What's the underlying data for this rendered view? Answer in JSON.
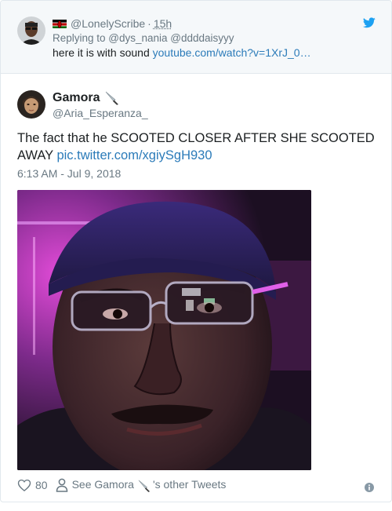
{
  "parent_tweet": {
    "handle": "@LonelyScribe",
    "separator": "·",
    "time": "15h",
    "replying_to": "Replying to @dys_nania @ddddaisyyy",
    "text": "here it is with sound ",
    "link": "youtube.com/watch?v=1XrJ_0…",
    "flag_icon": "kenya-flag-icon"
  },
  "tweet": {
    "author_name": "Gamora",
    "author_handle": "@Aria_Esperanza_",
    "text_before_link": "The fact that he SCOOTED CLOSER AFTER SHE SCOOTED AWAY ",
    "link": "pic.twitter.com/xgiySgH930",
    "timestamp": "6:13 AM - Jul 9, 2018"
  },
  "actions": {
    "likes": "80",
    "see_prefix": "See Gamora",
    "see_suffix": "'s other Tweets"
  },
  "colors": {
    "link": "#2b7bb9",
    "twitter_blue": "#1da1f2",
    "muted": "#697882",
    "text": "#1c2022"
  }
}
